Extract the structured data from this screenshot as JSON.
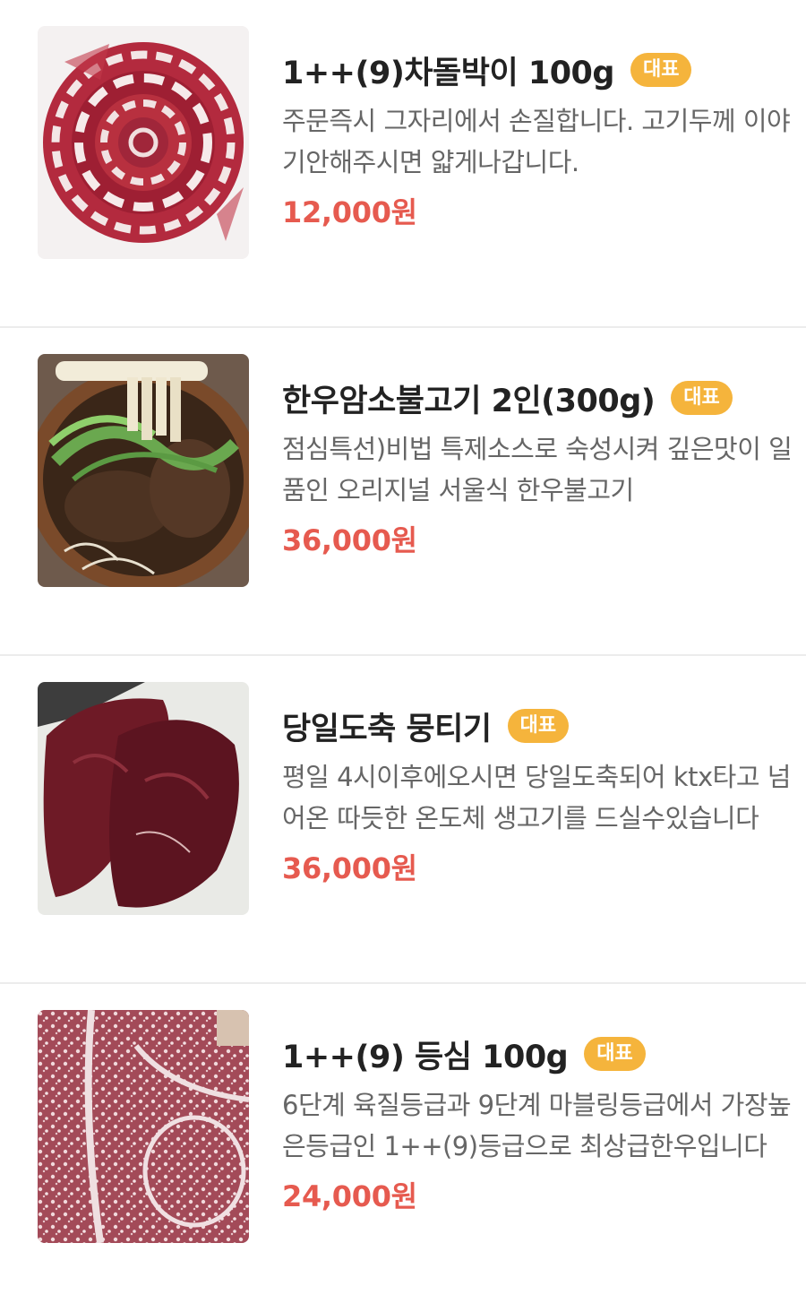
{
  "colors": {
    "badge_bg": "#f5b43c",
    "price": "#e65a4f",
    "title": "#222222",
    "description": "#666666"
  },
  "menu": {
    "items": [
      {
        "name": "1++(9)차돌박이 100g",
        "badge": "대표",
        "description": "주문즉시 그자리에서 손질합니다. 고기두께 이야기안해주시면 얇게나갑니다.",
        "price": "12,000원",
        "image": "sliced-brisket-photo"
      },
      {
        "name": "한우암소불고기 2인(300g)",
        "badge": "대표",
        "description": "점심특선)비법 특제소스로 숙성시켜 깊은맛이 일품인 오리지널 서울식 한우불고기",
        "price": "36,000원",
        "image": "bulgogi-hotpot-photo"
      },
      {
        "name": "당일도축 뭉티기",
        "badge": "대표",
        "description": "평일 4시이후에오시면 당일도축되어 ktx타고 넘어온 따듯한 온도체 생고기를 드실수있습니다",
        "price": "36,000원",
        "image": "raw-beef-slab-photo"
      },
      {
        "name": "1++(9) 등심 100g",
        "badge": "대표",
        "description": "6단계 육질등급과 9단계 마블링등급에서 가장높은등급인 1++(9)등급으로 최상급한우입니다",
        "price": "24,000원",
        "image": "marbled-sirloin-photo"
      }
    ]
  }
}
